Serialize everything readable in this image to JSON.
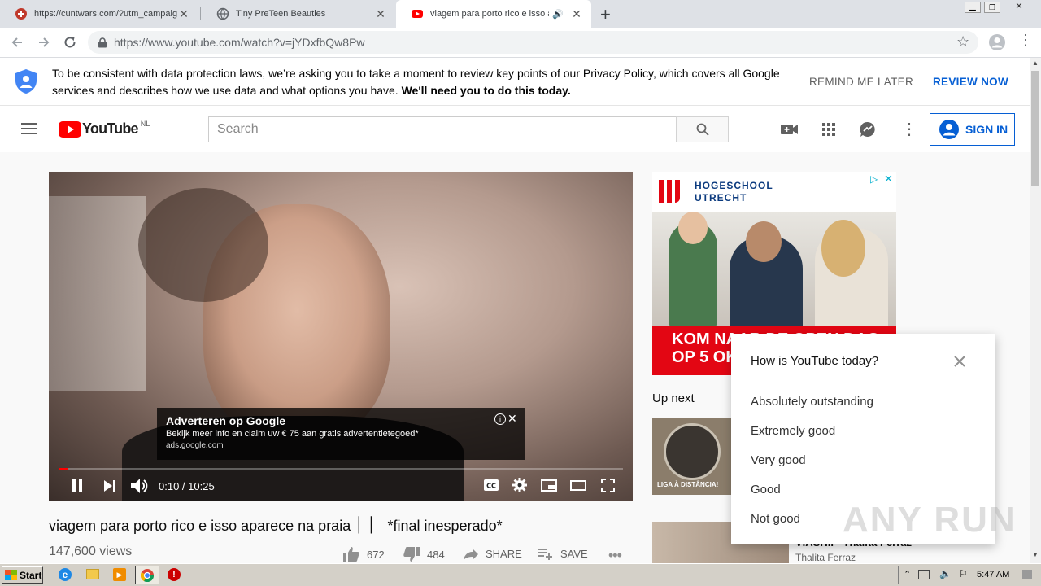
{
  "browser": {
    "tabs": [
      {
        "title": "https://cuntwars.com/?utm_campaig",
        "active": false
      },
      {
        "title": "Tiny PreTeen Beauties",
        "active": false
      },
      {
        "title": "viagem para porto rico e isso ap",
        "active": true
      }
    ],
    "new_tab": "+",
    "url": "https://www.youtube.com/watch?v=jYDxfbQw8Pw"
  },
  "consent": {
    "text_normal": "To be consistent with data protection laws, we’re asking you to take a moment to review key points of our Privacy Policy, which covers all Google services and describes how we use data and what options you have. ",
    "text_bold": "We'll need you to do this today.",
    "remind_label": "REMIND ME LATER",
    "review_label": "REVIEW NOW"
  },
  "header": {
    "logo_text": "YouTube",
    "region": "NL",
    "search_placeholder": "Search",
    "signin_label": "SIGN IN"
  },
  "player": {
    "ad_title": "Adverteren op Google",
    "ad_desc": "Bekijk meer info en claim uw € 75 aan gratis advertentietegoed*",
    "ad_url": "ads.google.com",
    "time": "0:10 / 10:25",
    "progress": 0.016
  },
  "video_info": {
    "title": "viagem para porto rico e isso aparece na praia ׀ ׀   *final inesperado*",
    "views": "147,600 views",
    "likes": "672",
    "dislikes": "484",
    "share_label": "SHARE",
    "save_label": "SAVE"
  },
  "side_ad": {
    "brand_line1": "HOGESCHOOL",
    "brand_line2": "UTRECHT",
    "banner_line1": "KOM NAAR DE OPEN DAG",
    "banner_line2": "OP 5 OKT"
  },
  "up_next": {
    "heading": "Up next",
    "thumb1_caption": "LIGA À DISTÂNCIA!",
    "item2_channel": "Thalita Ferraz",
    "item2_title": "VIASHII - Thalita Ferraz"
  },
  "survey": {
    "question": "How is YouTube today?",
    "options": [
      "Absolutely outstanding",
      "Extremely good",
      "Very good",
      "Good",
      "Not good"
    ]
  },
  "watermark": "ANY RUN",
  "taskbar": {
    "start_label": "Start",
    "clock": "5:47 AM"
  }
}
